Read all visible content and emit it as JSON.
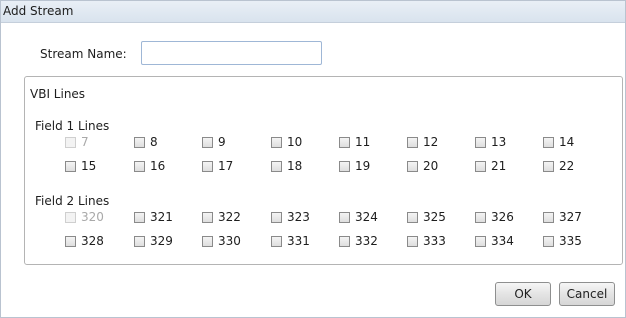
{
  "window": {
    "title": "Add Stream"
  },
  "stream_name": {
    "label": "Stream Name:",
    "value": "",
    "placeholder": ""
  },
  "vbi_group": {
    "title": "VBI Lines",
    "field1": {
      "label": "Field 1 Lines",
      "lines": [
        {
          "label": "7",
          "checked": false,
          "disabled": true
        },
        {
          "label": "8",
          "checked": false,
          "disabled": false
        },
        {
          "label": "9",
          "checked": false,
          "disabled": false
        },
        {
          "label": "10",
          "checked": false,
          "disabled": false
        },
        {
          "label": "11",
          "checked": false,
          "disabled": false
        },
        {
          "label": "12",
          "checked": false,
          "disabled": false
        },
        {
          "label": "13",
          "checked": false,
          "disabled": false
        },
        {
          "label": "14",
          "checked": false,
          "disabled": false
        },
        {
          "label": "15",
          "checked": false,
          "disabled": false
        },
        {
          "label": "16",
          "checked": false,
          "disabled": false
        },
        {
          "label": "17",
          "checked": false,
          "disabled": false
        },
        {
          "label": "18",
          "checked": false,
          "disabled": false
        },
        {
          "label": "19",
          "checked": false,
          "disabled": false
        },
        {
          "label": "20",
          "checked": false,
          "disabled": false
        },
        {
          "label": "21",
          "checked": false,
          "disabled": false
        },
        {
          "label": "22",
          "checked": false,
          "disabled": false
        }
      ]
    },
    "field2": {
      "label": "Field 2 Lines",
      "lines": [
        {
          "label": "320",
          "checked": false,
          "disabled": true
        },
        {
          "label": "321",
          "checked": false,
          "disabled": false
        },
        {
          "label": "322",
          "checked": false,
          "disabled": false
        },
        {
          "label": "323",
          "checked": false,
          "disabled": false
        },
        {
          "label": "324",
          "checked": false,
          "disabled": false
        },
        {
          "label": "325",
          "checked": false,
          "disabled": false
        },
        {
          "label": "326",
          "checked": false,
          "disabled": false
        },
        {
          "label": "327",
          "checked": false,
          "disabled": false
        },
        {
          "label": "328",
          "checked": false,
          "disabled": false
        },
        {
          "label": "329",
          "checked": false,
          "disabled": false
        },
        {
          "label": "330",
          "checked": false,
          "disabled": false
        },
        {
          "label": "331",
          "checked": false,
          "disabled": false
        },
        {
          "label": "332",
          "checked": false,
          "disabled": false
        },
        {
          "label": "333",
          "checked": false,
          "disabled": false
        },
        {
          "label": "334",
          "checked": false,
          "disabled": false
        },
        {
          "label": "335",
          "checked": false,
          "disabled": false
        }
      ]
    }
  },
  "buttons": {
    "ok": "OK",
    "cancel": "Cancel"
  },
  "colors": {
    "titlebar": "#dde6f0",
    "input_border": "#9fb7d6",
    "disabled_text": "#a9a9a9"
  }
}
